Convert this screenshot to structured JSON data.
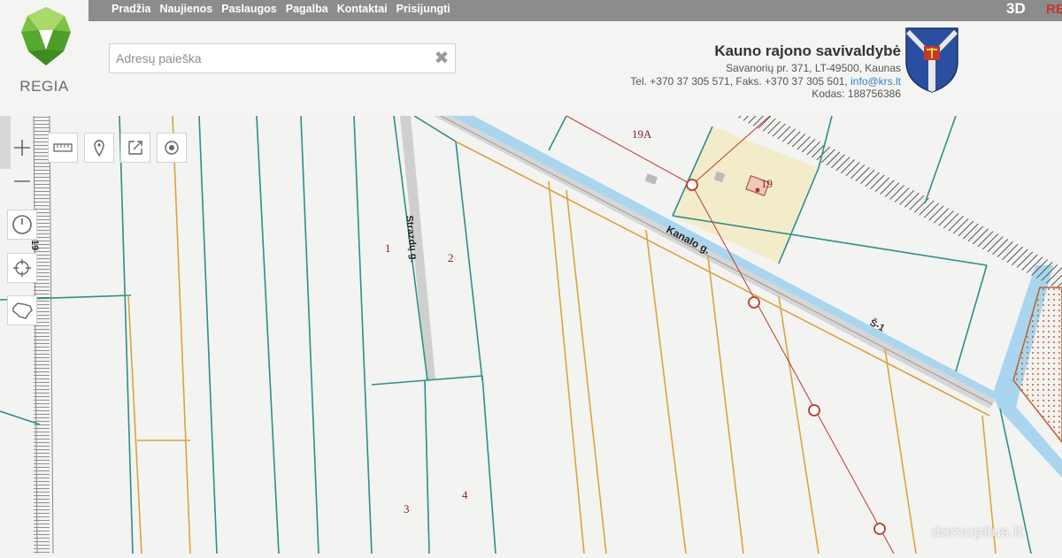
{
  "nav": {
    "items": [
      {
        "label": "Pradžia"
      },
      {
        "label": "Naujienos"
      },
      {
        "label": "Paslaugos"
      },
      {
        "label": "Pagalba"
      },
      {
        "label": "Kontaktai"
      },
      {
        "label": "Prisijungti"
      }
    ],
    "mode_3d": "3D",
    "mode_partial": "RE"
  },
  "brand": {
    "logo_text": "REGIA",
    "logo_icon": "regia-drop-logo"
  },
  "search": {
    "placeholder": "Adresų paieška",
    "value": "",
    "clear_icon": "close-icon"
  },
  "municipality": {
    "name": "Kauno rajono savivaldybė",
    "address": "Savanorių pr. 371, LT-49500, Kaunas",
    "phone_line": "Tel. +370 37 305 571, Faks. +370 37 305 501,",
    "email": "info@krs.lt",
    "code": "Kodas: 188756386",
    "crest_icon": "coat-of-arms-icon"
  },
  "tools": [
    {
      "name": "zoom-in",
      "icon": "plus-icon"
    },
    {
      "name": "zoom-out",
      "icon": "minus-icon"
    },
    {
      "name": "history",
      "icon": "clock-icon"
    },
    {
      "name": "locate",
      "icon": "crosshair-icon"
    },
    {
      "name": "extent",
      "icon": "lithuania-icon"
    },
    {
      "name": "measure",
      "icon": "ruler-icon"
    },
    {
      "name": "marker",
      "icon": "pin-icon"
    },
    {
      "name": "share",
      "icon": "share-icon"
    },
    {
      "name": "target",
      "icon": "target-icon"
    }
  ],
  "map_labels": {
    "parcel_19a": "19A",
    "parcel_19": "19",
    "parcel_1": "1",
    "parcel_2": "2",
    "parcel_3": "3",
    "parcel_4": "4",
    "street_strazdu": "Strazdų g.",
    "street_kanalo": "Kanalo g.",
    "road_s1": "Š-1",
    "left_edge": "19"
  },
  "colors": {
    "parcel_line": "#2e8f88",
    "land_line": "#d9a441",
    "canal": "#a9d6ee",
    "power_line": "#c0392b",
    "building_zone": "#f3eccb",
    "hatch_zone": "#e8a27a"
  },
  "watermark": "domoplius.lt"
}
